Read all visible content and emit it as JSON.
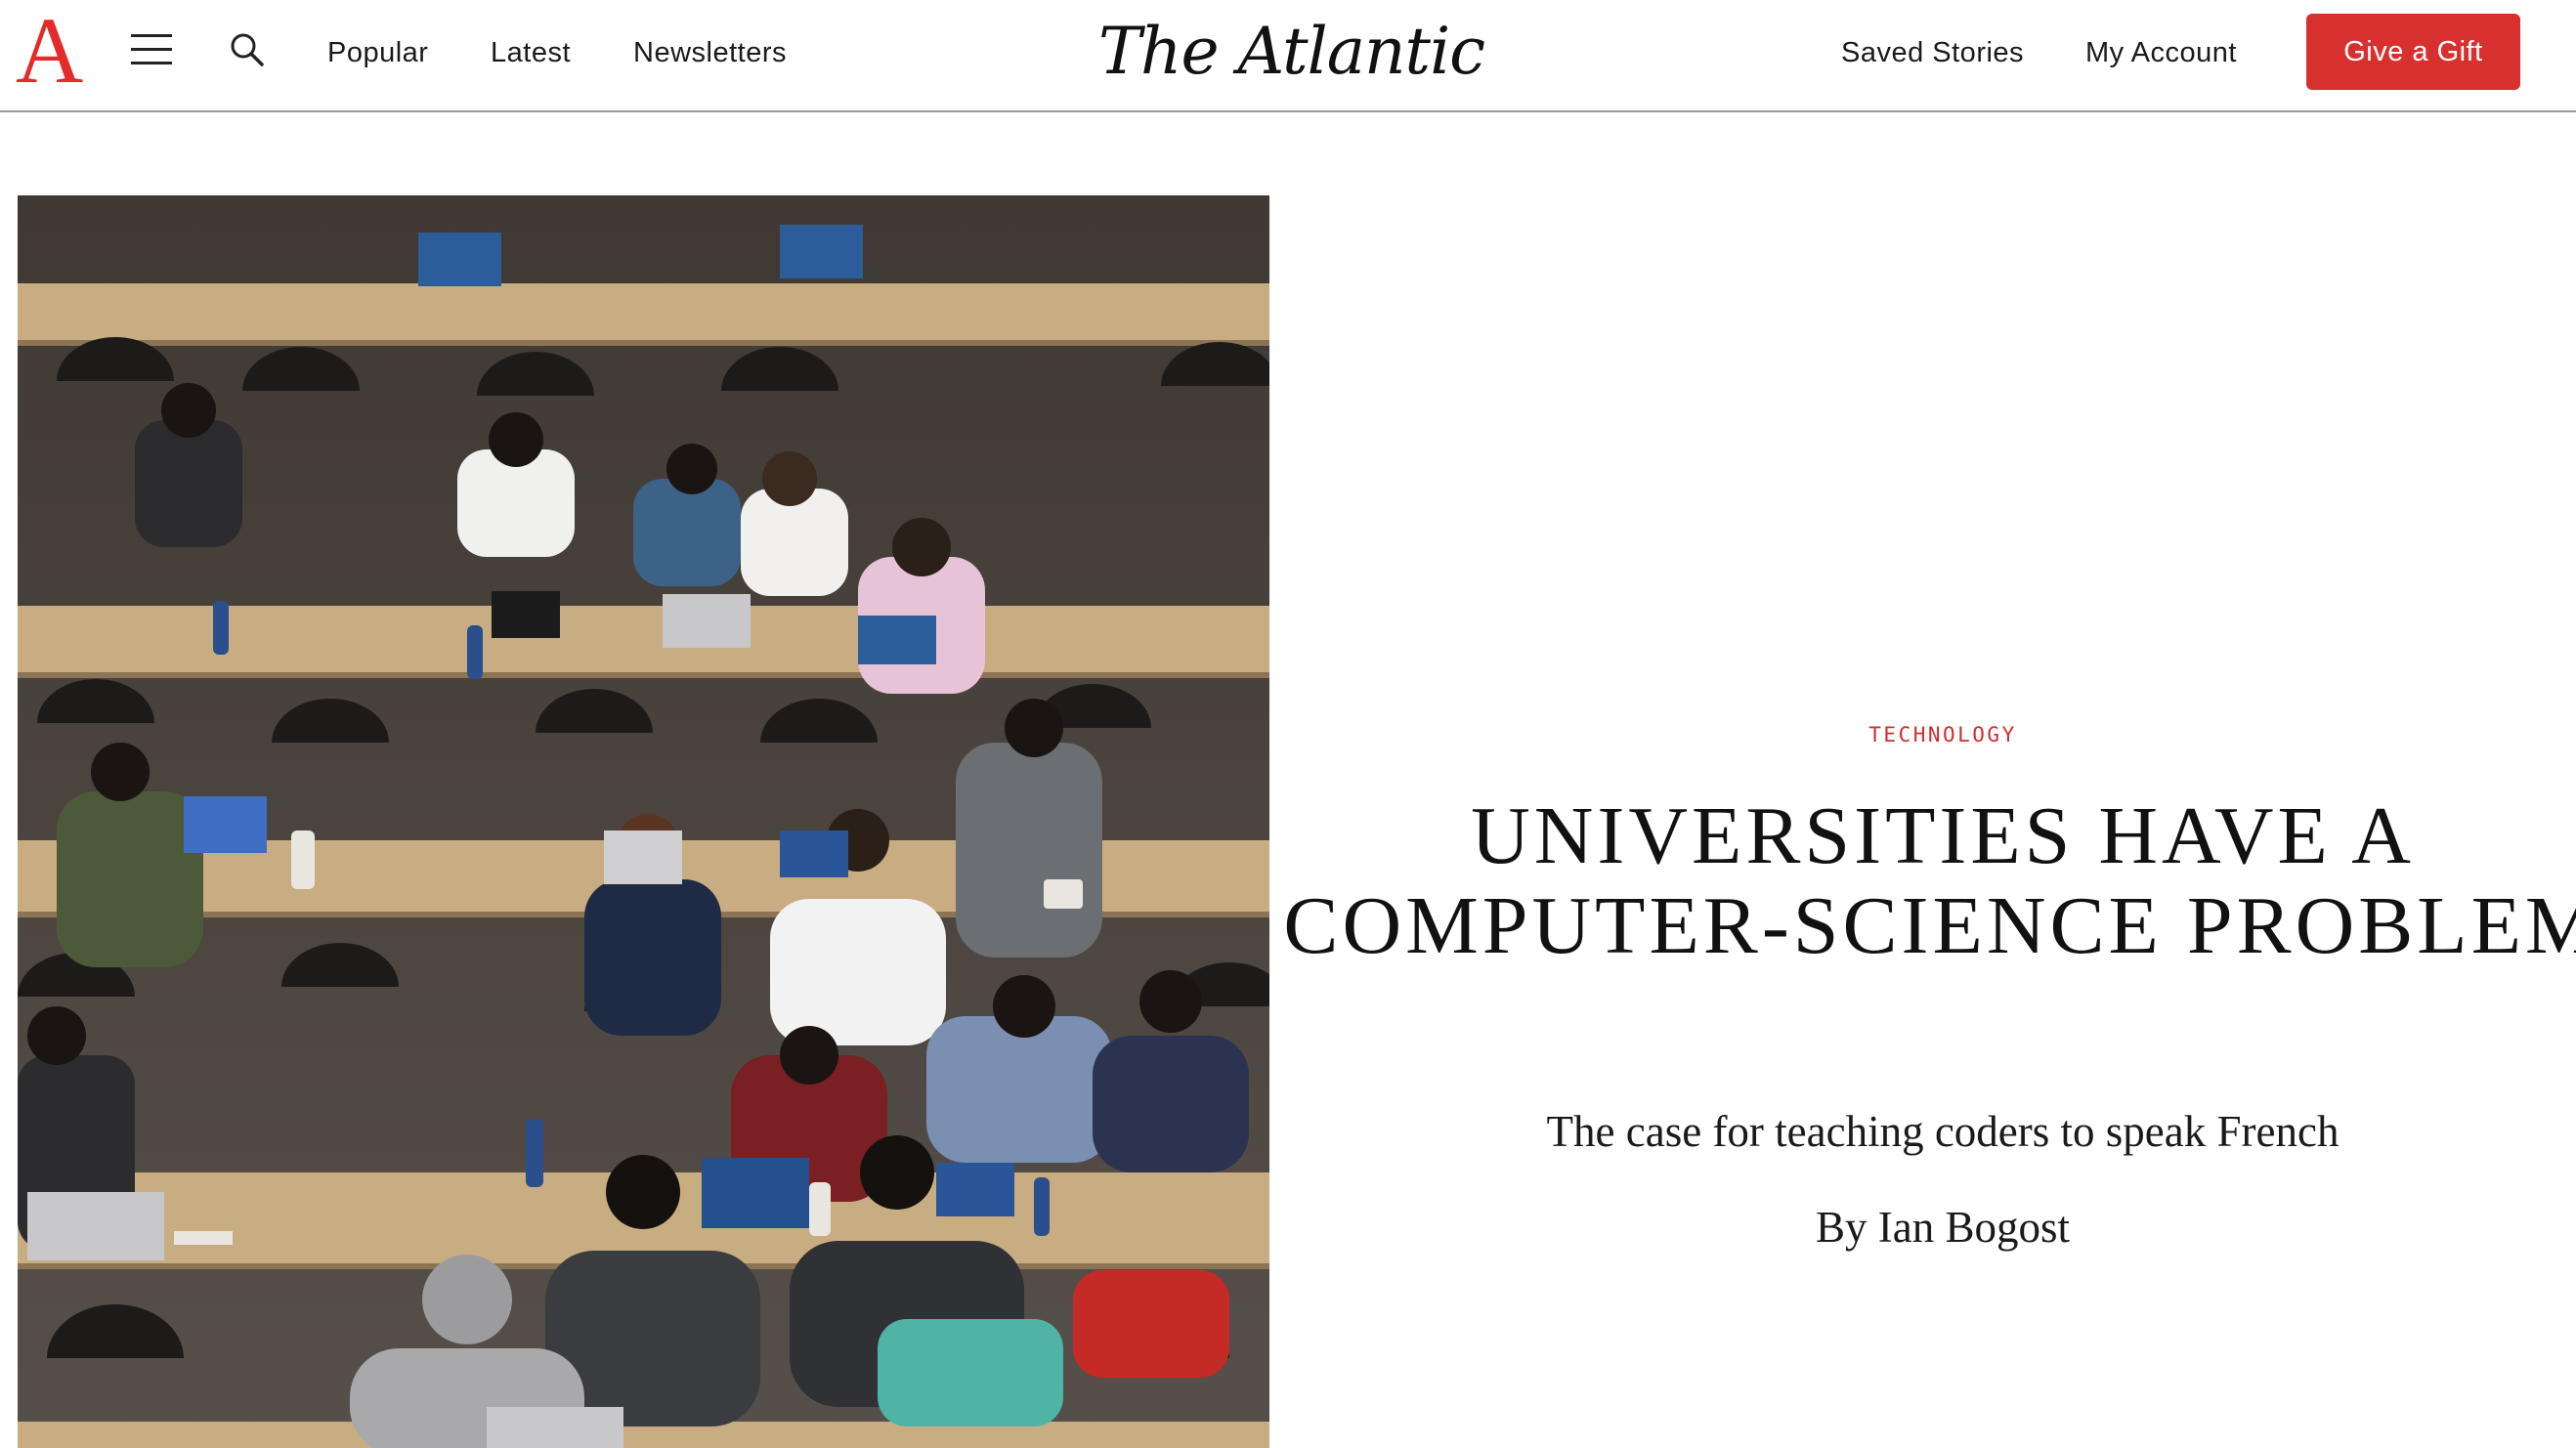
{
  "header": {
    "logo_letter": "A",
    "menu_icon": "hamburger-icon",
    "search_icon": "search-icon",
    "nav": [
      "Popular",
      "Latest",
      "Newsletters"
    ],
    "brand": "The Atlantic",
    "right_links": [
      "Saved Stories",
      "My Account"
    ],
    "gift_button": "Give a Gift",
    "accent_color": "#d7302e"
  },
  "hero": {
    "image_alt": "Students working on laptops at long tables during a hackathon"
  },
  "article": {
    "section": "TECHNOLOGY",
    "headline": "UNIVERSITIES HAVE A COMPUTER-SCIENCE PROBLEM",
    "dek": "The case for teaching coders to speak French",
    "byline": "By Ian Bogost"
  }
}
